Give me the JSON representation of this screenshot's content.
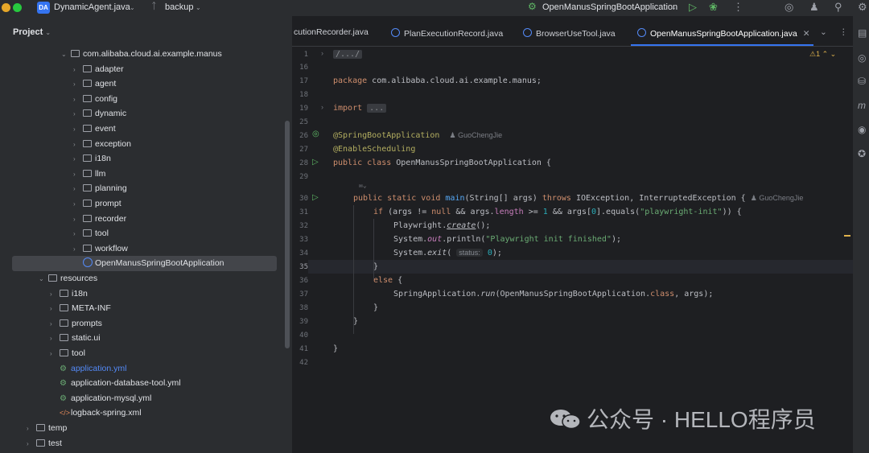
{
  "topbar": {
    "project_badge": "DA",
    "project_name": "DynamicAgent.java",
    "branch": "backup",
    "run_config": "OpenManusSpringBootApplication"
  },
  "project_panel": {
    "title": "Project",
    "tree": [
      {
        "label": "com.alibaba.cloud.ai.example.manus",
        "type": "folder",
        "expanded": true
      },
      {
        "label": "adapter",
        "type": "folder"
      },
      {
        "label": "agent",
        "type": "folder"
      },
      {
        "label": "config",
        "type": "folder"
      },
      {
        "label": "dynamic",
        "type": "folder"
      },
      {
        "label": "event",
        "type": "folder"
      },
      {
        "label": "exception",
        "type": "folder"
      },
      {
        "label": "i18n",
        "type": "folder"
      },
      {
        "label": "llm",
        "type": "folder"
      },
      {
        "label": "planning",
        "type": "folder"
      },
      {
        "label": "prompt",
        "type": "folder"
      },
      {
        "label": "recorder",
        "type": "folder"
      },
      {
        "label": "tool",
        "type": "folder"
      },
      {
        "label": "workflow",
        "type": "folder"
      },
      {
        "label": "OpenManusSpringBootApplication",
        "type": "java",
        "selected": true
      },
      {
        "label": "resources",
        "type": "folder",
        "expanded": true
      },
      {
        "label": "i18n",
        "type": "folder"
      },
      {
        "label": "META-INF",
        "type": "folder"
      },
      {
        "label": "prompts",
        "type": "folder"
      },
      {
        "label": "static.ui",
        "type": "folder"
      },
      {
        "label": "tool",
        "type": "folder"
      },
      {
        "label": "application.yml",
        "type": "yml"
      },
      {
        "label": "application-database-tool.yml",
        "type": "yml"
      },
      {
        "label": "application-mysql.yml",
        "type": "yml"
      },
      {
        "label": "logback-spring.xml",
        "type": "xml"
      },
      {
        "label": "temp",
        "type": "folder"
      },
      {
        "label": "test",
        "type": "folder"
      }
    ]
  },
  "editor": {
    "tabs": [
      {
        "label": "cutionRecorder.java"
      },
      {
        "label": "PlanExecutionRecord.java"
      },
      {
        "label": "BrowserUseTool.java"
      },
      {
        "label": "OpenManusSpringBootApplication.java",
        "active": true
      }
    ],
    "warning_count": "1",
    "line_numbers": [
      "1",
      "16",
      "17",
      "18",
      "19",
      "25",
      "26",
      "27",
      "28",
      "29",
      "30",
      "31",
      "32",
      "33",
      "34",
      "35",
      "36",
      "37",
      "38",
      "39",
      "40",
      "41",
      "42"
    ],
    "folded_header": "/.../",
    "package_kw": "package",
    "package_name": " com.alibaba.cloud.ai.example.manus;",
    "import_kw": "import",
    "import_fold": "...",
    "annotation1": "@SpringBootApplication",
    "author": "GuoChengJie",
    "annotation2": "@EnableScheduling",
    "class_decl_kw": "public class",
    "class_name": " OpenManusSpringBootApplication {",
    "inlay_icon": "✉⌄",
    "main_kw1": "public static void",
    "main_fn": "main",
    "main_params": "(String[] args) ",
    "main_throws": "throws",
    "main_exc": " IOException, InterruptedException {",
    "if_line": {
      "kw": "if",
      "a": " (args != ",
      "null": "null",
      "b": " && args.",
      "field": "length",
      "c": " >= ",
      "num1": "1",
      "d": " && args[",
      "num0": "0",
      "e": "].equals(",
      "str": "\"playwright-init\"",
      "f": ")) {"
    },
    "pw_line": {
      "a": "Playwright.",
      "fn": "create",
      "b": "();"
    },
    "println_line": {
      "a": "System.",
      "field": "out",
      "b": ".println(",
      "str": "\"Playwright init finished\"",
      "c": ");"
    },
    "exit_line": {
      "a": "System.",
      "fn": "exit",
      "b": "( ",
      "hint": "status:",
      "num": "0",
      "c": ");"
    },
    "close_brace": "}",
    "else_kw": "else",
    "else_rest": " {",
    "run_line": {
      "a": "SpringApplication.",
      "fn": "run",
      "b": "(OpenManusSpringBootApplication.",
      "kw": "class",
      "c": ", args);"
    }
  },
  "watermark": "公众号 · HELLO程序员"
}
